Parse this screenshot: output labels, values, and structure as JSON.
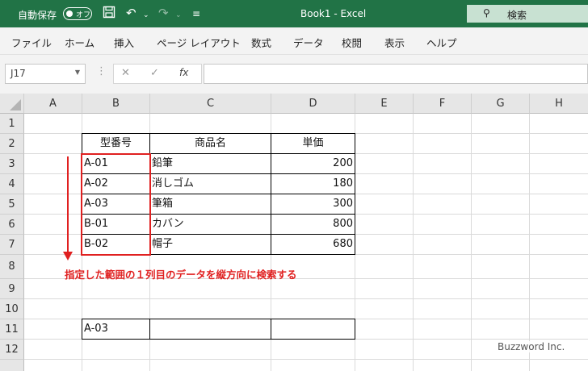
{
  "titlebar": {
    "autosave_label": "自動保存",
    "autosave_toggle": "オフ",
    "doc_title": "Book1 - Excel",
    "search_placeholder": "検索"
  },
  "menu": [
    "ファイル",
    "ホーム",
    "挿入",
    "ページ レイアウト",
    "数式",
    "データ",
    "校閲",
    "表示",
    "ヘルプ"
  ],
  "formula_bar": {
    "name_box": "J17",
    "value": ""
  },
  "columns": [
    "A",
    "B",
    "C",
    "D",
    "E",
    "F",
    "G",
    "H"
  ],
  "rows": [
    "1",
    "2",
    "3",
    "4",
    "5",
    "6",
    "7",
    "8",
    "9",
    "10",
    "11",
    "12"
  ],
  "table": {
    "headers": [
      "型番号",
      "商品名",
      "単価"
    ],
    "rows": [
      [
        "A-01",
        "鉛筆",
        "200"
      ],
      [
        "A-02",
        "消しゴム",
        "180"
      ],
      [
        "A-03",
        "筆箱",
        "300"
      ],
      [
        "B-01",
        "カバン",
        "800"
      ],
      [
        "B-02",
        "帽子",
        "680"
      ]
    ]
  },
  "lookup_cell": "A-03",
  "annotation": "指定した範囲の１列目のデータを縦方向に検索する",
  "watermark": "Buzzword Inc.",
  "colors": {
    "excel_green": "#217346",
    "annotation_red": "#e02020"
  }
}
